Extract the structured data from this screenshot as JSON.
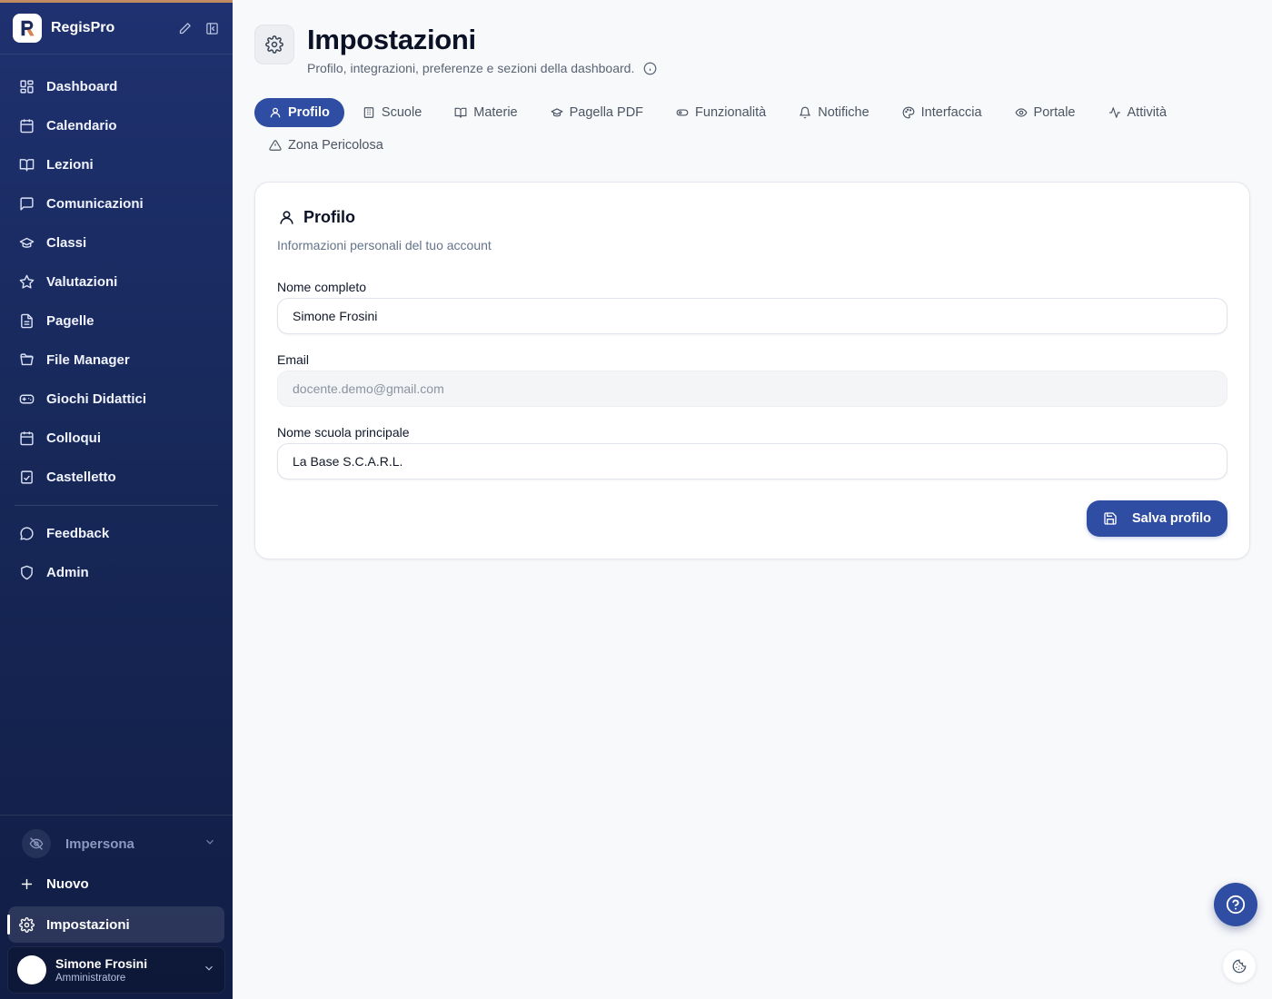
{
  "sidebar": {
    "brand_name": "RegisPro",
    "nav_items": [
      {
        "label": "Dashboard",
        "icon": "dashboard-grid-icon"
      },
      {
        "label": "Calendario",
        "icon": "calendar-icon"
      },
      {
        "label": "Lezioni",
        "icon": "book-open-icon"
      },
      {
        "label": "Comunicazioni",
        "icon": "message-square-icon"
      },
      {
        "label": "Classi",
        "icon": "graduation-cap-icon"
      },
      {
        "label": "Valutazioni",
        "icon": "star-icon"
      },
      {
        "label": "Pagelle",
        "icon": "file-text-icon"
      },
      {
        "label": "File Manager",
        "icon": "folder-open-icon"
      },
      {
        "label": "Giochi Didattici",
        "icon": "gamepad-icon"
      },
      {
        "label": "Colloqui",
        "icon": "calendar-check-icon"
      },
      {
        "label": "Castelletto",
        "icon": "clipboard-check-icon"
      }
    ],
    "secondary_items": [
      {
        "label": "Feedback",
        "icon": "message-circle-icon"
      },
      {
        "label": "Admin",
        "icon": "shield-icon"
      }
    ],
    "impersona_label": "Impersona",
    "new_label": "Nuovo",
    "settings_label": "Impostazioni",
    "user": {
      "name": "Simone Frosini",
      "role": "Amministratore"
    }
  },
  "header": {
    "title": "Impostazioni",
    "subtitle": "Profilo, integrazioni, preferenze e sezioni della dashboard."
  },
  "tabs": [
    {
      "label": "Profilo",
      "icon": "user-icon",
      "active": true
    },
    {
      "label": "Scuole",
      "icon": "building-icon",
      "active": false
    },
    {
      "label": "Materie",
      "icon": "book-open-icon",
      "active": false
    },
    {
      "label": "Pagella PDF",
      "icon": "graduation-cap-icon",
      "active": false
    },
    {
      "label": "Funzionalità",
      "icon": "toggle-icon",
      "active": false
    },
    {
      "label": "Notifiche",
      "icon": "bell-icon",
      "active": false
    },
    {
      "label": "Interfaccia",
      "icon": "palette-icon",
      "active": false
    },
    {
      "label": "Portale",
      "icon": "eye-icon",
      "active": false
    },
    {
      "label": "Attività",
      "icon": "activity-icon",
      "active": false
    },
    {
      "label": "Zona Pericolosa",
      "icon": "alert-triangle-icon",
      "active": false
    }
  ],
  "profile_card": {
    "title": "Profilo",
    "description": "Informazioni personali del tuo account",
    "fields": {
      "full_name": {
        "label": "Nome completo",
        "value": "Simone Frosini"
      },
      "email": {
        "label": "Email",
        "value": "docente.demo@gmail.com",
        "disabled": true
      },
      "school": {
        "label": "Nome scuola principale",
        "value": "La Base S.C.A.R.L."
      }
    },
    "save_label": "Salva profilo"
  },
  "colors": {
    "accent": "#2f4ea3",
    "sidebar_top": "#1f3170",
    "sidebar_bottom": "#111d44",
    "page_bg": "#f8f9fb"
  }
}
